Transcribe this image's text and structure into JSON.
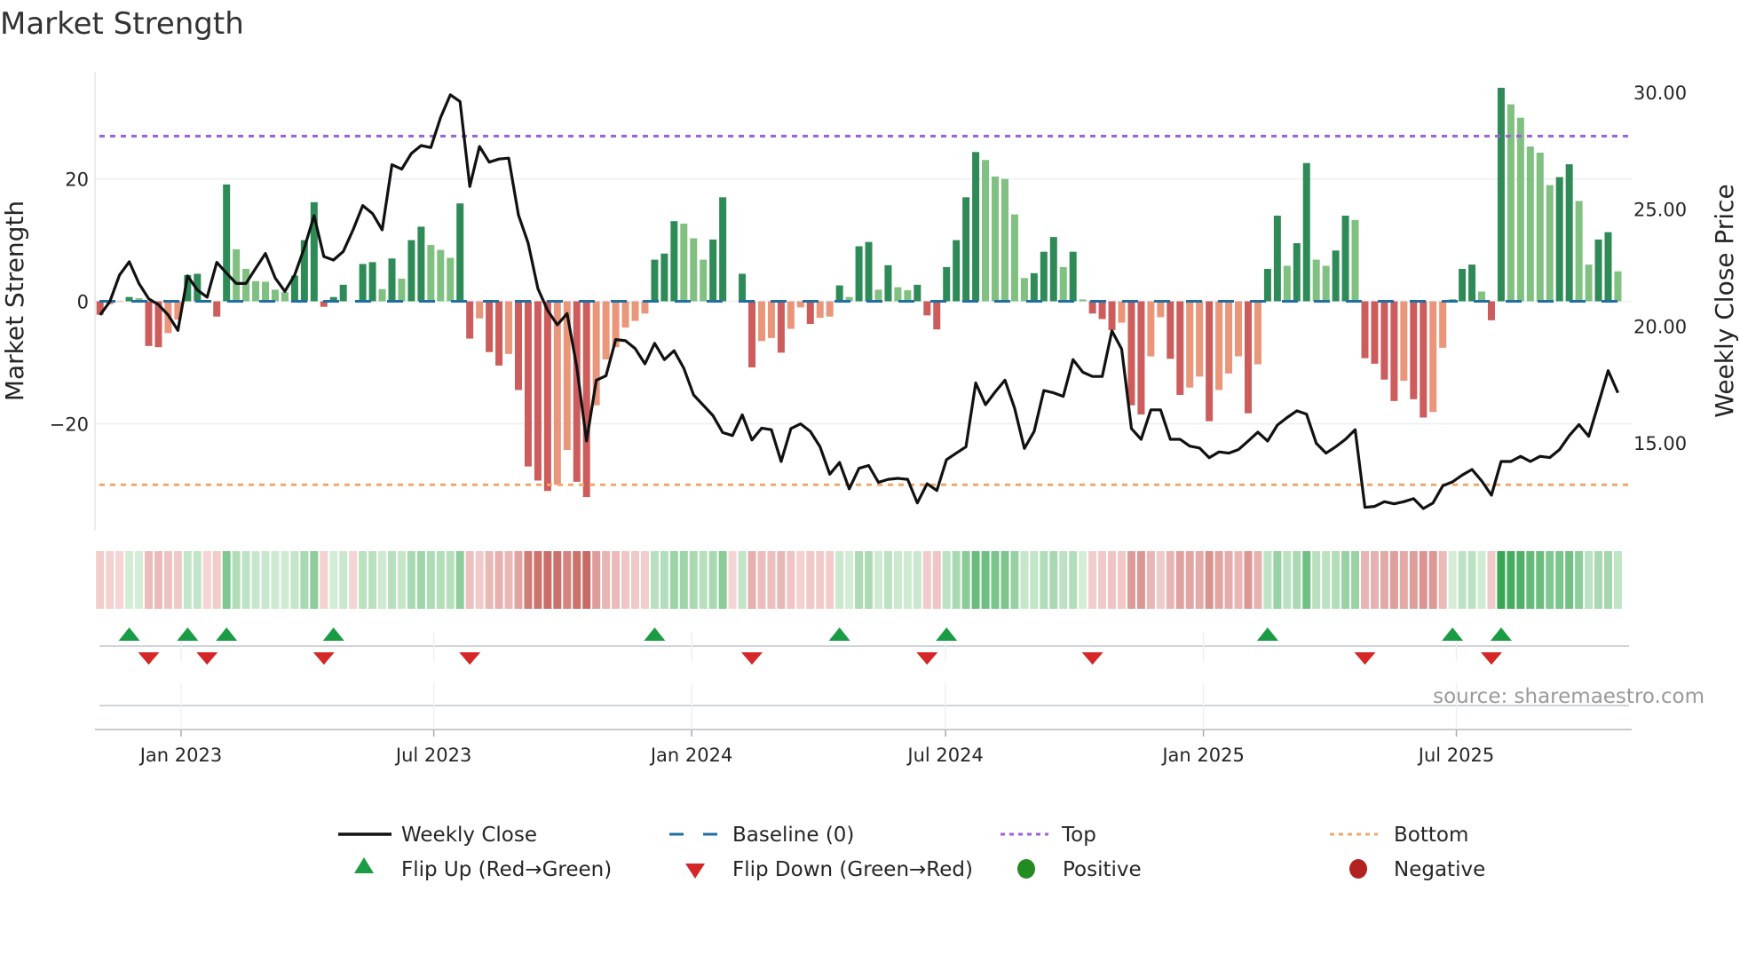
{
  "chart_data": {
    "type": "bar",
    "title": "Market Strength",
    "ylabel_left": "Market Strength",
    "ylabel_right": "Weekly Close Price",
    "ylim_left": [
      -37.5,
      37.5
    ],
    "ylim_right": [
      11.24,
      30.87
    ],
    "yticks_left": [
      {
        "value": 20,
        "label": "20"
      },
      {
        "value": 0,
        "label": "0"
      },
      {
        "value": -20,
        "label": "−20"
      }
    ],
    "yticks_right": [
      {
        "value": 30,
        "label": "30.00"
      },
      {
        "value": 25,
        "label": "25.00"
      },
      {
        "value": 20,
        "label": "20.00"
      },
      {
        "value": 15,
        "label": "15.00"
      }
    ],
    "xticks": [
      {
        "label": "Jan 2023",
        "week": 8.33
      },
      {
        "label": "Jul 2023",
        "week": 34.3
      },
      {
        "label": "Jan 2024",
        "week": 60.8
      },
      {
        "label": "Jul 2024",
        "week": 86.9
      },
      {
        "label": "Jan 2025",
        "week": 113.4
      },
      {
        "label": "Jul 2025",
        "week": 139.4
      }
    ],
    "top_level": 27,
    "bottom_level": -30,
    "baseline": 0,
    "grid": true,
    "legend_placement": "bottom",
    "strength": [
      -2.2,
      -0.5,
      -0.1,
      0.7,
      0.5,
      -7.3,
      -7.5,
      -5.2,
      -3.0,
      4.3,
      4.5,
      0,
      -2.5,
      19.1,
      8.5,
      5.3,
      3.3,
      3.2,
      1.9,
      1.5,
      4.2,
      10.0,
      16.2,
      -0.9,
      0.7,
      2.7,
      0,
      6.1,
      6.4,
      2.0,
      7.0,
      3.7,
      10.0,
      12.2,
      9.2,
      8.4,
      7.1,
      16.0,
      -6.1,
      -2.8,
      -8.3,
      -10.5,
      -8.6,
      -14.5,
      -27,
      -29.3,
      -31,
      -30,
      -24.3,
      -29.5,
      -32,
      -17,
      -9.5,
      -7.5,
      -4.3,
      -3.2,
      -2,
      6.8,
      7.8,
      13.1,
      12.7,
      10.3,
      6.8,
      10.1,
      17,
      0,
      4.5,
      -10.8,
      -6.5,
      -6,
      -8.4,
      -4.5,
      -1,
      -3.7,
      -2.7,
      -2.5,
      2.6,
      0.7,
      9,
      9.7,
      1.9,
      5.9,
      2.3,
      1.8,
      2.7,
      -2.3,
      -4.6,
      5.6,
      10,
      17,
      24.4,
      23.1,
      20.4,
      20,
      14.2,
      3.8,
      4.6,
      8.1,
      10.5,
      5.6,
      8.1,
      0.3,
      -2,
      -2.9,
      -4.7,
      -3.5,
      -17,
      -18.5,
      -9,
      -2.6,
      -9.4,
      -15.3,
      -14.1,
      -12.3,
      -19.6,
      -14.5,
      -11.8,
      -9,
      -18.3,
      -10.3,
      5.3,
      14,
      5.8,
      9.5,
      22.6,
      6.8,
      5.8,
      8.3,
      14,
      13.3,
      -9.3,
      -10.2,
      -12.8,
      -16.3,
      -13,
      -16,
      -19,
      -18.1,
      -7.6,
      0.3,
      5.3,
      6,
      1.6,
      -3.1,
      34.9,
      32.2,
      30,
      25.3,
      24.3,
      19,
      20.3,
      22.4,
      16.4,
      6,
      10.1,
      11.3,
      4.9
    ],
    "shade": "RrrGgRRrrGGGRGggggggGGGRGGGGGgGgGGgggGRrRRrRRRRrrRRrrrrrrGGGgggGGGGRrrRrrRrrGgGGgGggGRRGGGGgggggGGGgGgRRRrRRrrRRrrRrrrRrGGgGGggGGgRRRRrRRrrGGGgRGgggggGGggGGg",
    "weekly_close": [
      20.47,
      21.04,
      22.18,
      22.75,
      21.82,
      21.16,
      20.91,
      20.47,
      19.81,
      22.14,
      21.54,
      21.23,
      22.72,
      22.26,
      21.82,
      21.82,
      22.47,
      23.1,
      22.05,
      21.48,
      22.18,
      23.35,
      24.72,
      22.97,
      22.82,
      23.19,
      24.11,
      25.15,
      24.81,
      24.11,
      26.9,
      26.71,
      27.38,
      27.72,
      27.63,
      28.92,
      29.89,
      29.6,
      25.97,
      27.68,
      27.01,
      27.14,
      27.18,
      24.75,
      23.55,
      21.6,
      20.66,
      20.05,
      20.53,
      18.25,
      15.08,
      17.68,
      17.87,
      19.42,
      19.37,
      19.03,
      18.38,
      19.26,
      18.56,
      18.94,
      18.19,
      17.05,
      16.61,
      16.16,
      15.44,
      15.31,
      16.2,
      15.12,
      15.63,
      15.56,
      14.2,
      15.61,
      15.81,
      15.49,
      14.83,
      13.66,
      14.16,
      13.03,
      13.91,
      14.03,
      13.31,
      13.44,
      13.48,
      13.44,
      12.43,
      13.25,
      12.96,
      14.28,
      14.56,
      14.83,
      17.56,
      16.63,
      17.18,
      17.68,
      16.48,
      14.76,
      15.49,
      17.24,
      17.14,
      16.99,
      18.56,
      18.02,
      17.84,
      17.84,
      19.79,
      19.01,
      15.61,
      15.15,
      16.41,
      16.41,
      15.15,
      15.15,
      14.86,
      14.78,
      14.36,
      14.61,
      14.56,
      14.71,
      15.08,
      15.46,
      15.08,
      15.76,
      16.08,
      16.37,
      16.23,
      14.98,
      14.56,
      14.83,
      15.15,
      15.56,
      12.24,
      12.28,
      12.48,
      12.39,
      12.48,
      12.61,
      12.19,
      12.43,
      13.16,
      13.33,
      13.62,
      13.86,
      13.37,
      12.76,
      14.2,
      14.2,
      14.42,
      14.2,
      14.42,
      14.37,
      14.71,
      15.31,
      15.78,
      15.28,
      16.67,
      18.09,
      17.14
    ],
    "flip_up_weeks": [
      3,
      9,
      13,
      24,
      57,
      76,
      87,
      120,
      139,
      144
    ],
    "flip_down_weeks": [
      5,
      11,
      23,
      38,
      67,
      85,
      102,
      130,
      143
    ],
    "legend": {
      "weekly_close": "Weekly Close",
      "baseline": "Baseline (0)",
      "top": "Top",
      "bottom": "Bottom",
      "flip_up": "Flip Up (Red→Green)",
      "flip_down": "Flip Down (Green→Red)",
      "positive": "Positive",
      "negative": "Negative"
    }
  },
  "source": "source: sharemaestro.com",
  "colors": {
    "strong_green": "#2e8b57",
    "weak_green": "#80c080",
    "strong_red": "#cd5c5c",
    "weak_red": "#e9967a",
    "baseline": "#1f6fa3",
    "top": "#9b5fe0",
    "bottom": "#f0a868",
    "line": "#111111",
    "flip_up": "#1a9c45",
    "flip_down": "#d62728",
    "positive": "#228b22",
    "negative": "#b22222"
  }
}
